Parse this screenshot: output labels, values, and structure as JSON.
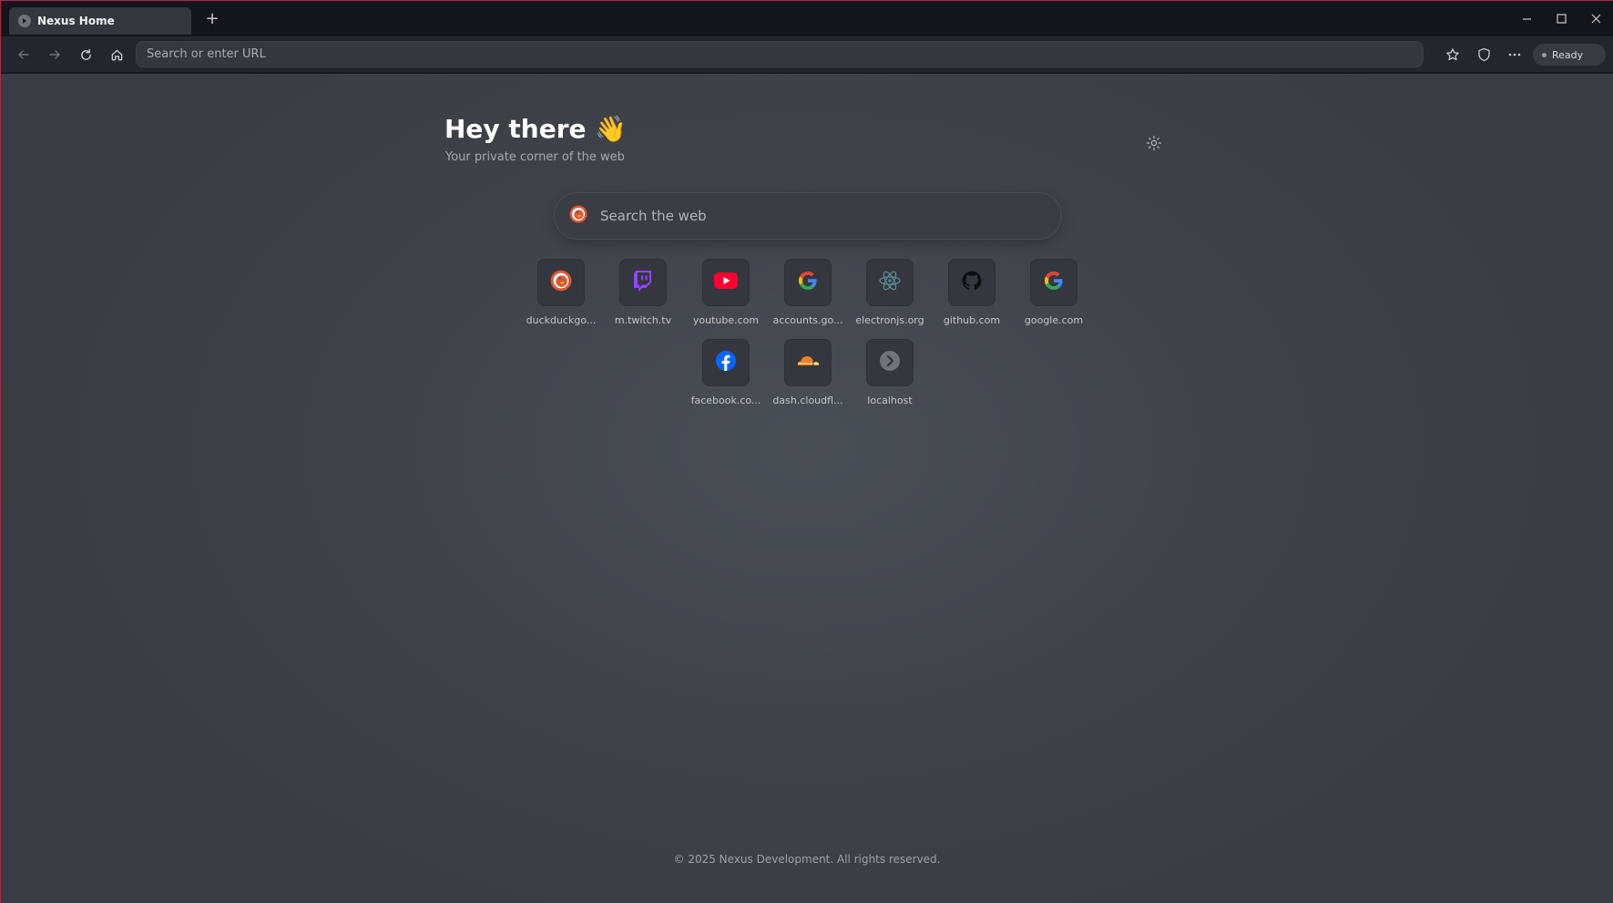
{
  "browser": {
    "tab": {
      "title": "Nexus Home",
      "favicon": "nexus-icon"
    },
    "new_tab_label": "+",
    "window_controls": [
      "minimize-icon",
      "maximize-icon",
      "close-icon"
    ]
  },
  "toolbar": {
    "url_placeholder": "Search or enter URL",
    "url_value": "",
    "status": "Ready",
    "buttons": [
      "back-icon",
      "forward-icon",
      "reload-icon",
      "home-icon",
      "star-icon",
      "shield-icon",
      "more-icon"
    ]
  },
  "page": {
    "greeting": "Hey there 👋",
    "tagline": "Your private corner of the web",
    "search_placeholder": "Search the web",
    "search_engine_icon": "duckduckgo-icon",
    "shortcuts": [
      {
        "label": "duckduckgo...",
        "icon": "duckduckgo-icon"
      },
      {
        "label": "m.twitch.tv",
        "icon": "twitch-icon"
      },
      {
        "label": "youtube.com",
        "icon": "youtube-icon"
      },
      {
        "label": "accounts.go...",
        "icon": "google-icon"
      },
      {
        "label": "electronjs.org",
        "icon": "electron-icon"
      },
      {
        "label": "github.com",
        "icon": "github-icon"
      },
      {
        "label": "google.com",
        "icon": "google-icon"
      },
      {
        "label": "facebook.co...",
        "icon": "facebook-icon"
      },
      {
        "label": "dash.cloudfl...",
        "icon": "cloudflare-icon"
      },
      {
        "label": "localhost",
        "icon": "localhost-icon"
      }
    ],
    "footer": "© 2025 Nexus Development. All rights reserved."
  },
  "colors": {
    "accent_border": "#b02a4a",
    "page_bg": "#45484f",
    "toolbar_bg": "#23262c"
  }
}
